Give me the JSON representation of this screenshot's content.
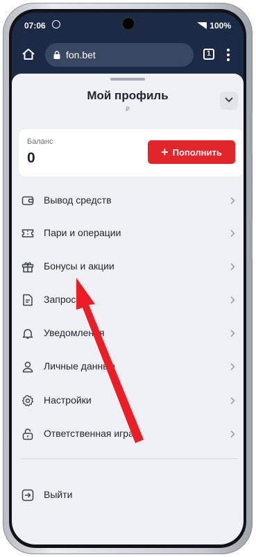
{
  "status_bar": {
    "time": "07:06",
    "battery": "100%"
  },
  "browser": {
    "url": "fon.bet",
    "tab_count": "1"
  },
  "profile": {
    "title": "Мой профиль",
    "subtitle": "₽"
  },
  "balance": {
    "label": "Баланс",
    "value": "0",
    "topup_label": "Пополнить"
  },
  "menu": [
    {
      "label": "Вывод средств",
      "icon": "wallet-icon"
    },
    {
      "label": "Пари и операции",
      "icon": "ticket-icon"
    },
    {
      "label": "Бонусы и акции",
      "icon": "gift-icon"
    },
    {
      "label": "Запросы",
      "icon": "document-icon"
    },
    {
      "label": "Уведомления",
      "icon": "bell-icon"
    },
    {
      "label": "Личные данные",
      "icon": "user-icon"
    },
    {
      "label": "Настройки",
      "icon": "gear-icon"
    },
    {
      "label": "Ответственная игра",
      "icon": "lock-icon"
    }
  ],
  "logout": {
    "label": "Выйти",
    "icon": "logout-icon"
  },
  "colors": {
    "accent": "#e2242b",
    "header": "#1c2a45",
    "sheet": "#eef0f4",
    "annotation_arrow": "#ee1c24"
  }
}
